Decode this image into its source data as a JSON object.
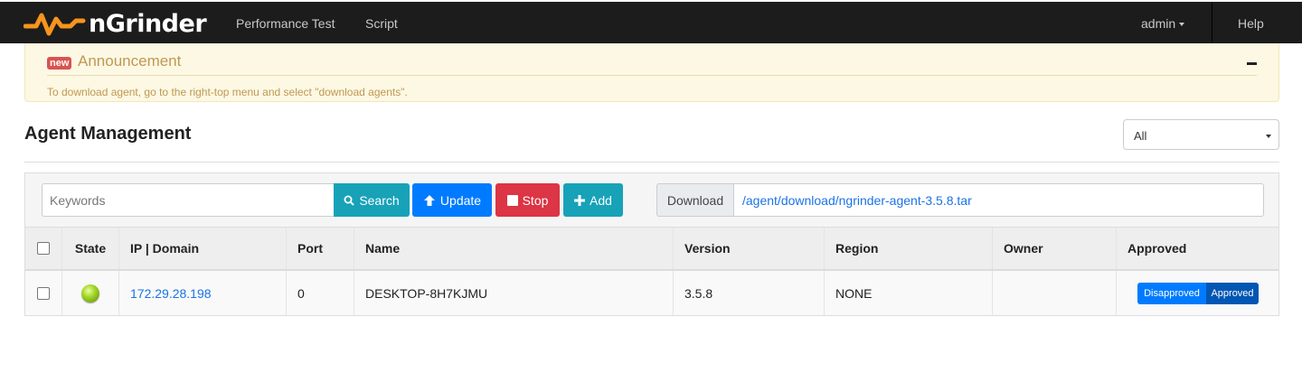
{
  "navbar": {
    "brand": "nGrinder",
    "links": [
      "Performance Test",
      "Script"
    ],
    "user_menu": "admin",
    "help": "Help",
    "accent_color": "#f7941d"
  },
  "announcement": {
    "badge": "new",
    "title": "Announcement",
    "text": "To download agent, go to the right-top menu and select \"download agents\".",
    "collapse_icon": "minus-icon"
  },
  "page": {
    "title": "Agent Management",
    "region_filter": "All"
  },
  "toolbar": {
    "keywords_placeholder": "Keywords",
    "search_label": "Search",
    "update_label": "Update",
    "stop_label": "Stop",
    "add_label": "Add",
    "download_label": "Download",
    "download_path": "/agent/download/ngrinder-agent-3.5.8.tar"
  },
  "table": {
    "headers": [
      "State",
      "IP | Domain",
      "Port",
      "Name",
      "Version",
      "Region",
      "Owner",
      "Approved"
    ],
    "rows": [
      {
        "state": "running",
        "ip": "172.29.28.198",
        "port": "0",
        "name": "DESKTOP-8H7KJMU",
        "version": "3.5.8",
        "region": "NONE",
        "owner": "",
        "approve_options": [
          "Disapproved",
          "Approved"
        ],
        "approved": "Approved"
      }
    ]
  }
}
